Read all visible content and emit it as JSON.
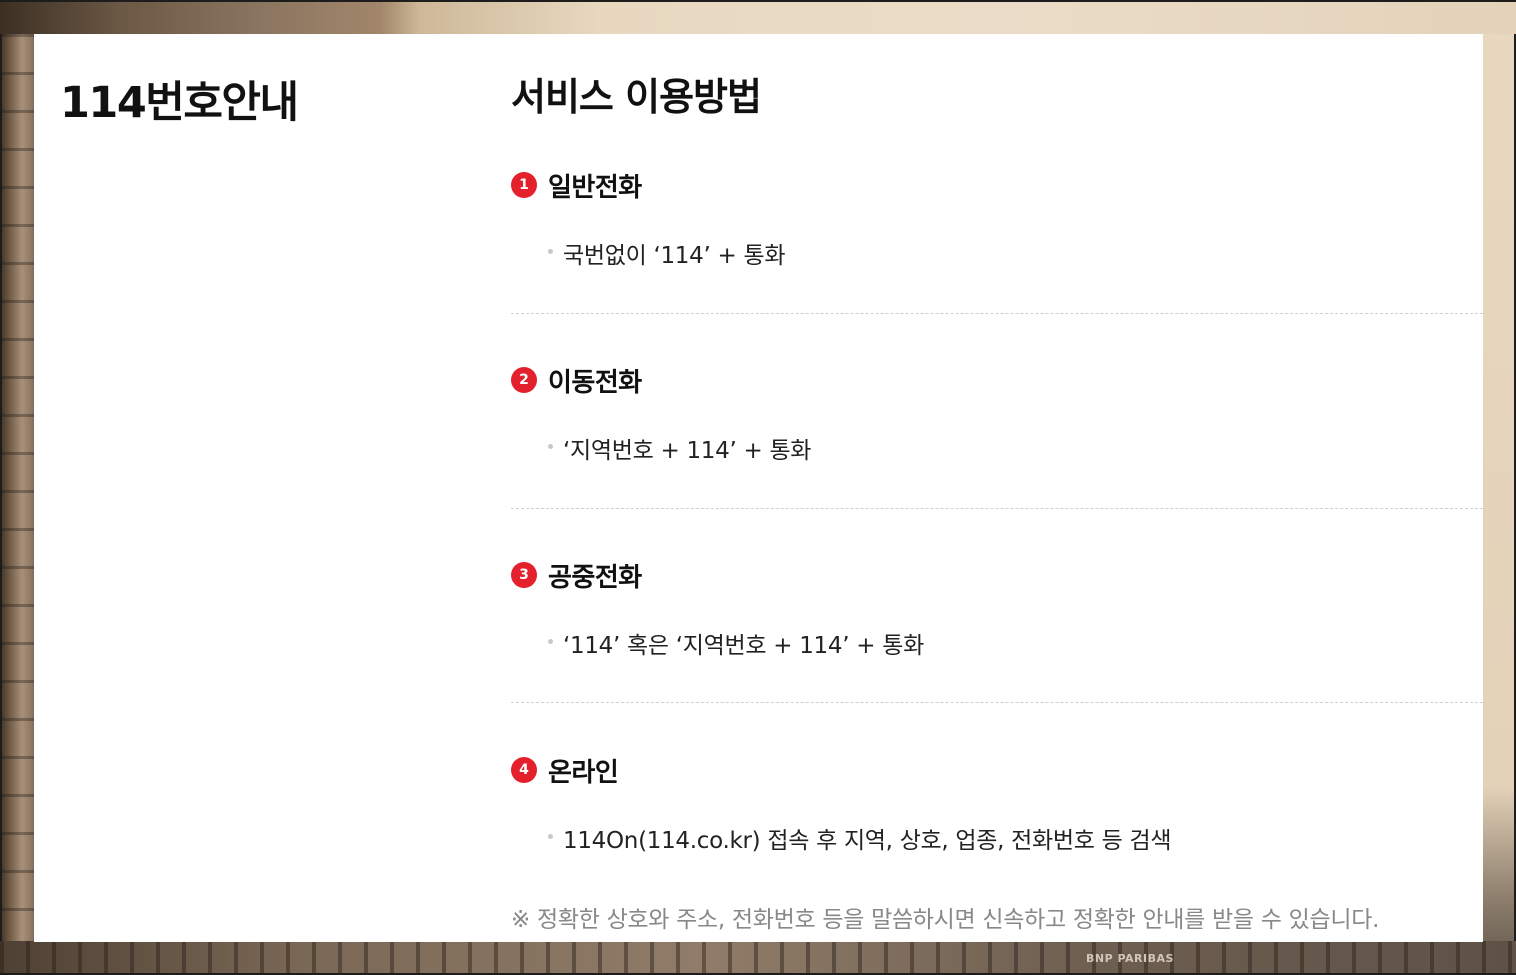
{
  "background": {
    "sign_text": "BNP PARIBAS"
  },
  "sidebar": {
    "title": "114번호안내"
  },
  "main": {
    "title": "서비스 이용방법",
    "sections": [
      {
        "number": "1",
        "title": "일반전화",
        "item": "국번없이 ‘114’ + 통화"
      },
      {
        "number": "2",
        "title": "이동전화",
        "item": "‘지역번호 + 114’ + 통화"
      },
      {
        "number": "3",
        "title": "공중전화",
        "item": "‘114’ 혹은 ‘지역번호 + 114’ + 통화"
      },
      {
        "number": "4",
        "title": "온라인",
        "item": "114On(114.co.kr) 접속 후 지역, 상호, 업종, 전화번호 등 검색"
      }
    ],
    "note": "※ 정확한 상호와 주소, 전화번호 등을 말씀하시면 신속하고 정확한 안내를 받을 수 있습니다."
  },
  "colors": {
    "accent": "#e4202d",
    "text": "#111111",
    "muted": "#888888"
  }
}
